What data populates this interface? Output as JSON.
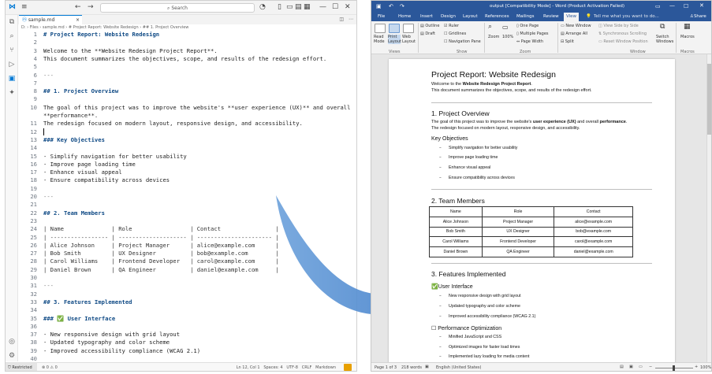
{
  "vscode": {
    "search_placeholder": "Search",
    "tab_label": "sample.md",
    "breadcrumb": "D: › Files › sample.md › # Project Report: Website Redesign › ## 1. Project Overview",
    "lines": [
      {
        "n": "1",
        "t": "# Project Report: Website Redesign"
      },
      {
        "n": "2",
        "t": ""
      },
      {
        "n": "3",
        "t": "Welcome to the **Website Redesign Project Report**."
      },
      {
        "n": "4",
        "t": "This document summarizes the objectives, scope, and results of the redesign effort."
      },
      {
        "n": "5",
        "t": ""
      },
      {
        "n": "6",
        "t": "---"
      },
      {
        "n": "7",
        "t": ""
      },
      {
        "n": "8",
        "t": "## 1. Project Overview"
      },
      {
        "n": "9",
        "t": ""
      },
      {
        "n": "10",
        "t": "The goal of this project was to improve the website's **user experience (UX)** and overall"
      },
      {
        "n": "",
        "t": "**performance**."
      },
      {
        "n": "11",
        "t": "The redesign focused on modern layout, responsive design, and accessibility."
      },
      {
        "n": "12",
        "t": ""
      },
      {
        "n": "13",
        "t": "### Key Objectives"
      },
      {
        "n": "14",
        "t": ""
      },
      {
        "n": "15",
        "t": "- Simplify navigation for better usability"
      },
      {
        "n": "16",
        "t": "- Improve page loading time"
      },
      {
        "n": "17",
        "t": "- Enhance visual appeal"
      },
      {
        "n": "18",
        "t": "- Ensure compatibility across devices"
      },
      {
        "n": "19",
        "t": ""
      },
      {
        "n": "20",
        "t": "---"
      },
      {
        "n": "21",
        "t": ""
      },
      {
        "n": "22",
        "t": "## 2. Team Members"
      },
      {
        "n": "23",
        "t": ""
      },
      {
        "n": "24",
        "t": "| Name              | Role                 | Contact                |"
      },
      {
        "n": "25",
        "t": "| ----------------- | -------------------- | ---------------------- |"
      },
      {
        "n": "26",
        "t": "| Alice Johnson     | Project Manager      | alice@example.com      |"
      },
      {
        "n": "27",
        "t": "| Bob Smith         | UX Designer          | bob@example.com        |"
      },
      {
        "n": "28",
        "t": "| Carol Williams    | Frontend Developer   | carol@example.com      |"
      },
      {
        "n": "29",
        "t": "| Daniel Brown      | QA Engineer          | daniel@example.com     |"
      },
      {
        "n": "30",
        "t": ""
      },
      {
        "n": "31",
        "t": "---"
      },
      {
        "n": "32",
        "t": ""
      },
      {
        "n": "33",
        "t": "## 3. Features Implemented"
      },
      {
        "n": "34",
        "t": ""
      },
      {
        "n": "35",
        "t": "### ✅ User Interface"
      },
      {
        "n": "36",
        "t": ""
      },
      {
        "n": "37",
        "t": "- New responsive design with grid layout"
      },
      {
        "n": "38",
        "t": "- Updated typography and color scheme"
      },
      {
        "n": "39",
        "t": "- Improved accessibility compliance (WCAG 2.1)"
      },
      {
        "n": "40",
        "t": ""
      },
      {
        "n": "41",
        "t": "### ⚙ Performance Optimization"
      }
    ],
    "status": {
      "remote": "Restricted Mode",
      "errors": "⊗ 0 ⚠ 0",
      "position": "Ln 12, Col 1",
      "spaces": "Spaces: 4",
      "encoding": "UTF-8",
      "eol": "CRLF",
      "language": "Markdown"
    },
    "colors": {
      "accent": "#0078d4",
      "heading": "#0f4a85"
    }
  },
  "word": {
    "title": "output [Compatibility Mode] - Word (Product Activation Failed)",
    "menu": [
      "File",
      "Home",
      "Insert",
      "Design",
      "Layout",
      "References",
      "Mailings",
      "Review",
      "View"
    ],
    "tell_me": "Tell me what you want to do...",
    "share": "Share",
    "ribbon": {
      "views": [
        "Read Mode",
        "Print Layout",
        "Web Layout"
      ],
      "show": [
        "Outline",
        "Draft",
        "Ruler",
        "Gridlines",
        "Navigation Pane"
      ],
      "zoom": [
        "Zoom",
        "100%",
        "One Page",
        "Multiple Pages",
        "Page Width"
      ],
      "window": [
        "New Window",
        "Arrange All",
        "Split",
        "View Side by Side",
        "Synchronous Scrolling",
        "Reset Window Position",
        "Switch Windows",
        "Macros"
      ],
      "groups": [
        "Views",
        "Show",
        "Zoom",
        "Window",
        "Macros"
      ]
    },
    "doc": {
      "title": "Project Report: Website Redesign",
      "welcome_pre": "Welcome to the ",
      "welcome_bold": "Website Redesign Project Report",
      "welcome_post": ".",
      "summary": "This document summarizes the objectives, scope, and results of the redesign effort.",
      "h_overview": "1. Project Overview",
      "goal_pre": "The goal of this project was to improve the website's ",
      "goal_bold1": "user experience (UX)",
      "goal_mid": " and overall ",
      "goal_bold2": "performance",
      "goal_post": ".",
      "focus": "The redesign focused on modern layout, responsive design, and accessibility.",
      "h_objectives": "Key Objectives",
      "objectives": [
        "Simplify navigation for better usability",
        "Improve page loading time",
        "Enhance visual appeal",
        "Ensure compatibility across devices"
      ],
      "h_team": "2. Team Members",
      "table_headers": [
        "Name",
        "Role",
        "Contact"
      ],
      "table_rows": [
        [
          "Alice Johnson",
          "Project Manager",
          "alice@example.com"
        ],
        [
          "Bob Smith",
          "UX Designer",
          "bob@example.com"
        ],
        [
          "Carol Williams",
          "Frontend Developer",
          "carol@example.com"
        ],
        [
          "Daniel Brown",
          "QA Engineer",
          "daniel@example.com"
        ]
      ],
      "h_features": "3. Features Implemented",
      "h_ui": "✅User Interface",
      "ui_items": [
        "New responsive design with grid layout",
        "Updated typography and color scheme",
        "Improved accessibility compliance (WCAG 2.1)"
      ],
      "h_perf": "☐ Performance Optimization",
      "perf_items": [
        "Minified JavaScript and CSS",
        "Optimized images for faster load times",
        "Implemented lazy loading for media content"
      ]
    },
    "status": {
      "page": "Page 1 of 3",
      "words": "218 words",
      "language": "English (United States)",
      "zoom": "100%"
    },
    "colors": {
      "brand": "#2b579a"
    }
  }
}
